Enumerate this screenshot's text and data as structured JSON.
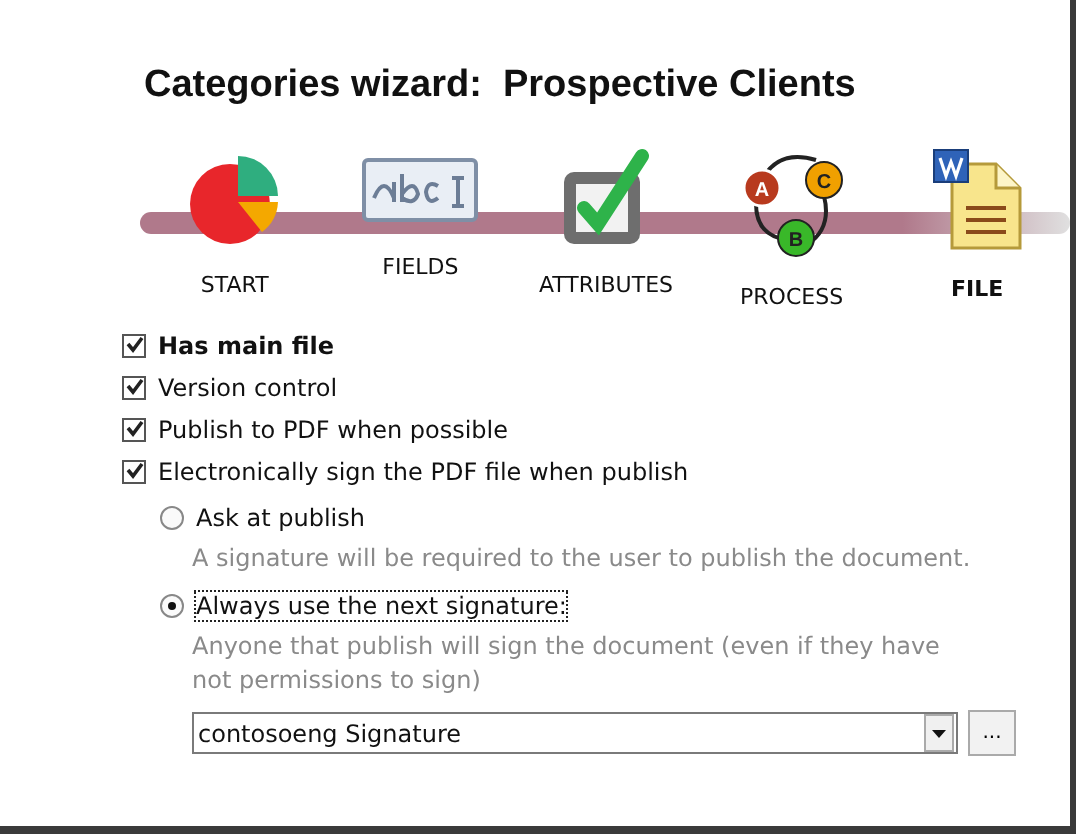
{
  "title": "Categories wizard:  Prospective Clients",
  "steps": [
    {
      "kind": "pie",
      "label": "START",
      "selected": false
    },
    {
      "kind": "text-field",
      "label": "FIELDS",
      "selected": false
    },
    {
      "kind": "checkmark",
      "label": "ATTRIBUTES",
      "selected": false
    },
    {
      "kind": "process",
      "label": "PROCESS",
      "selected": false,
      "badges": [
        "A",
        "C",
        "B"
      ]
    },
    {
      "kind": "document",
      "label": "FILE",
      "selected": true
    }
  ],
  "options": [
    {
      "label": "Has main file",
      "checked": true,
      "bold": true
    },
    {
      "label": "Version control",
      "checked": true,
      "bold": false
    },
    {
      "label": "Publish to PDF when possible",
      "checked": true,
      "bold": false
    },
    {
      "label": "Electronically sign the PDF file when publish",
      "checked": true,
      "bold": false
    }
  ],
  "signature_modes": [
    {
      "label": "Ask at publish",
      "selected": false,
      "focused": false,
      "description": "A signature will be required to the user to publish the document."
    },
    {
      "label": "Always use the next signature:",
      "selected": true,
      "focused": true,
      "description": "Anyone that publish will sign the document (even if they have not permissions to sign)"
    }
  ],
  "signature": {
    "value": "contosoeng Signature",
    "browse_button": "..."
  }
}
